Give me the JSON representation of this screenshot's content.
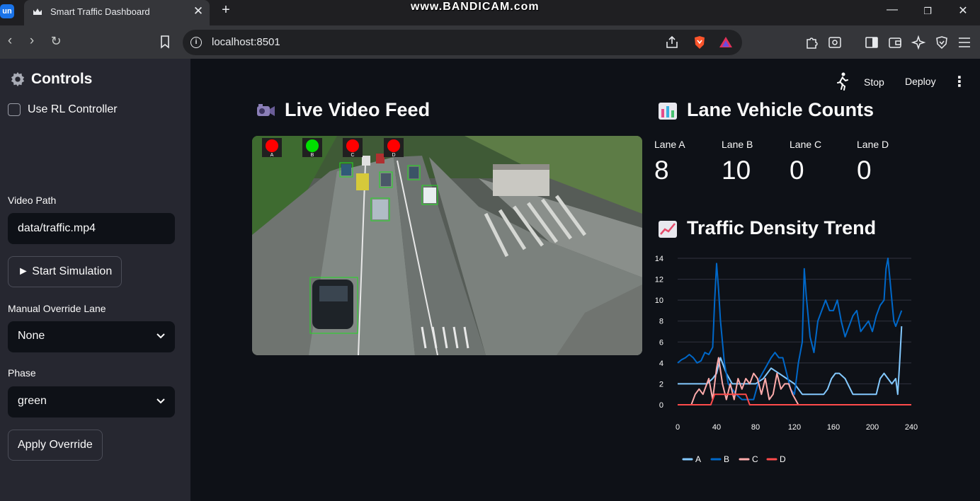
{
  "browser": {
    "app_badge": "un",
    "tab_title": "Smart Traffic Dashboard",
    "url": "localhost:8501",
    "watermark": "www.BANDICAM.com"
  },
  "header": {
    "stop_label": "Stop",
    "deploy_label": "Deploy"
  },
  "sidebar": {
    "title": "Controls",
    "rl_checkbox_label": "Use RL Controller",
    "rl_checked": false,
    "video_path_label": "Video Path",
    "video_path_value": "data/traffic.mp4",
    "start_button": "► Start Simulation",
    "override_lane_label": "Manual Override Lane",
    "override_lane_value": "None",
    "phase_label": "Phase",
    "phase_value": "green",
    "apply_button": "Apply Override"
  },
  "video": {
    "title": "Live Video Feed",
    "signals": [
      {
        "label": "A",
        "color": "#ff0000"
      },
      {
        "label": "B",
        "color": "#00e000"
      },
      {
        "label": "C",
        "color": "#ff0000"
      },
      {
        "label": "D",
        "color": "#ff0000"
      }
    ]
  },
  "counts": {
    "title": "Lane Vehicle Counts",
    "lanes": [
      {
        "label": "Lane A",
        "value": "8"
      },
      {
        "label": "Lane B",
        "value": "10"
      },
      {
        "label": "Lane C",
        "value": "0"
      },
      {
        "label": "Lane D",
        "value": "0"
      }
    ]
  },
  "trend": {
    "title": "Traffic Density Trend"
  },
  "chart_data": {
    "type": "line",
    "title": "Traffic Density Trend",
    "xlim": [
      0,
      240
    ],
    "ylim": [
      0,
      14
    ],
    "x_ticks": [
      0,
      40,
      80,
      120,
      160,
      200,
      240
    ],
    "y_ticks": [
      0,
      2,
      4,
      6,
      8,
      10,
      12,
      14
    ],
    "grid": true,
    "legend_position": "bottom",
    "series": [
      {
        "name": "A",
        "color": "#83c9ff",
        "x": [
          0,
          8,
          16,
          24,
          30,
          36,
          40,
          44,
          50,
          56,
          62,
          66,
          72,
          80,
          88,
          96,
          104,
          112,
          120,
          128,
          136,
          144,
          150,
          154,
          158,
          162,
          166,
          172,
          180,
          188,
          196,
          204,
          208,
          212,
          216,
          220,
          224,
          226,
          228,
          230
        ],
        "y": [
          2,
          2,
          2,
          2,
          2,
          2.5,
          3,
          4.5,
          3,
          2,
          2,
          2,
          2,
          2,
          2.5,
          3.5,
          3,
          2.5,
          2,
          1,
          1,
          1,
          1,
          1.5,
          2.5,
          3,
          3,
          2.5,
          1,
          1,
          1,
          1,
          2.5,
          3,
          2.5,
          2,
          2.5,
          1,
          4,
          7.5
        ]
      },
      {
        "name": "B",
        "color": "#0068c9",
        "x": [
          0,
          4,
          8,
          12,
          16,
          20,
          24,
          28,
          32,
          36,
          38,
          40,
          42,
          44,
          48,
          52,
          56,
          60,
          66,
          72,
          78,
          84,
          90,
          96,
          100,
          104,
          108,
          112,
          116,
          120,
          124,
          128,
          130,
          132,
          136,
          140,
          144,
          148,
          152,
          156,
          160,
          164,
          168,
          172,
          176,
          180,
          184,
          188,
          192,
          196,
          200,
          204,
          208,
          212,
          214,
          216,
          218,
          220,
          222,
          224,
          226,
          228,
          230
        ],
        "y": [
          4,
          4.3,
          4.5,
          4.8,
          4.5,
          4,
          4.2,
          5,
          4.8,
          5.5,
          10,
          13.5,
          11,
          8,
          4,
          2,
          1.5,
          1,
          0.5,
          0.5,
          0.5,
          2.5,
          3.5,
          4.5,
          5,
          4.5,
          4.5,
          3,
          1.5,
          1,
          4,
          6,
          13,
          10.5,
          6.5,
          5,
          8,
          9,
          10,
          9,
          9,
          10,
          8,
          6.5,
          7.5,
          8.5,
          9,
          7,
          7.5,
          8,
          7,
          8.5,
          9.5,
          10,
          13,
          14,
          12,
          10,
          8,
          7.5,
          8,
          8.5,
          9
        ]
      },
      {
        "name": "C",
        "color": "#ffabab",
        "x": [
          0,
          14,
          18,
          22,
          26,
          32,
          36,
          40,
          42,
          46,
          50,
          54,
          58,
          62,
          66,
          70,
          74,
          78,
          82,
          86,
          90,
          94,
          98,
          102,
          106,
          110,
          114,
          118,
          124,
          240
        ],
        "y": [
          0,
          0,
          1,
          1.5,
          1,
          2.5,
          0.5,
          3.5,
          4.5,
          2,
          0.5,
          2,
          0.5,
          2.5,
          1.5,
          2.5,
          2,
          3,
          2.5,
          1,
          2.5,
          0.5,
          1,
          3,
          1.5,
          2,
          2,
          1,
          0,
          0
        ]
      },
      {
        "name": "D",
        "color": "#ff4b4b",
        "x": [
          0,
          34,
          38,
          70,
          74,
          240
        ],
        "y": [
          0,
          0,
          1,
          1,
          0,
          0
        ]
      }
    ]
  }
}
